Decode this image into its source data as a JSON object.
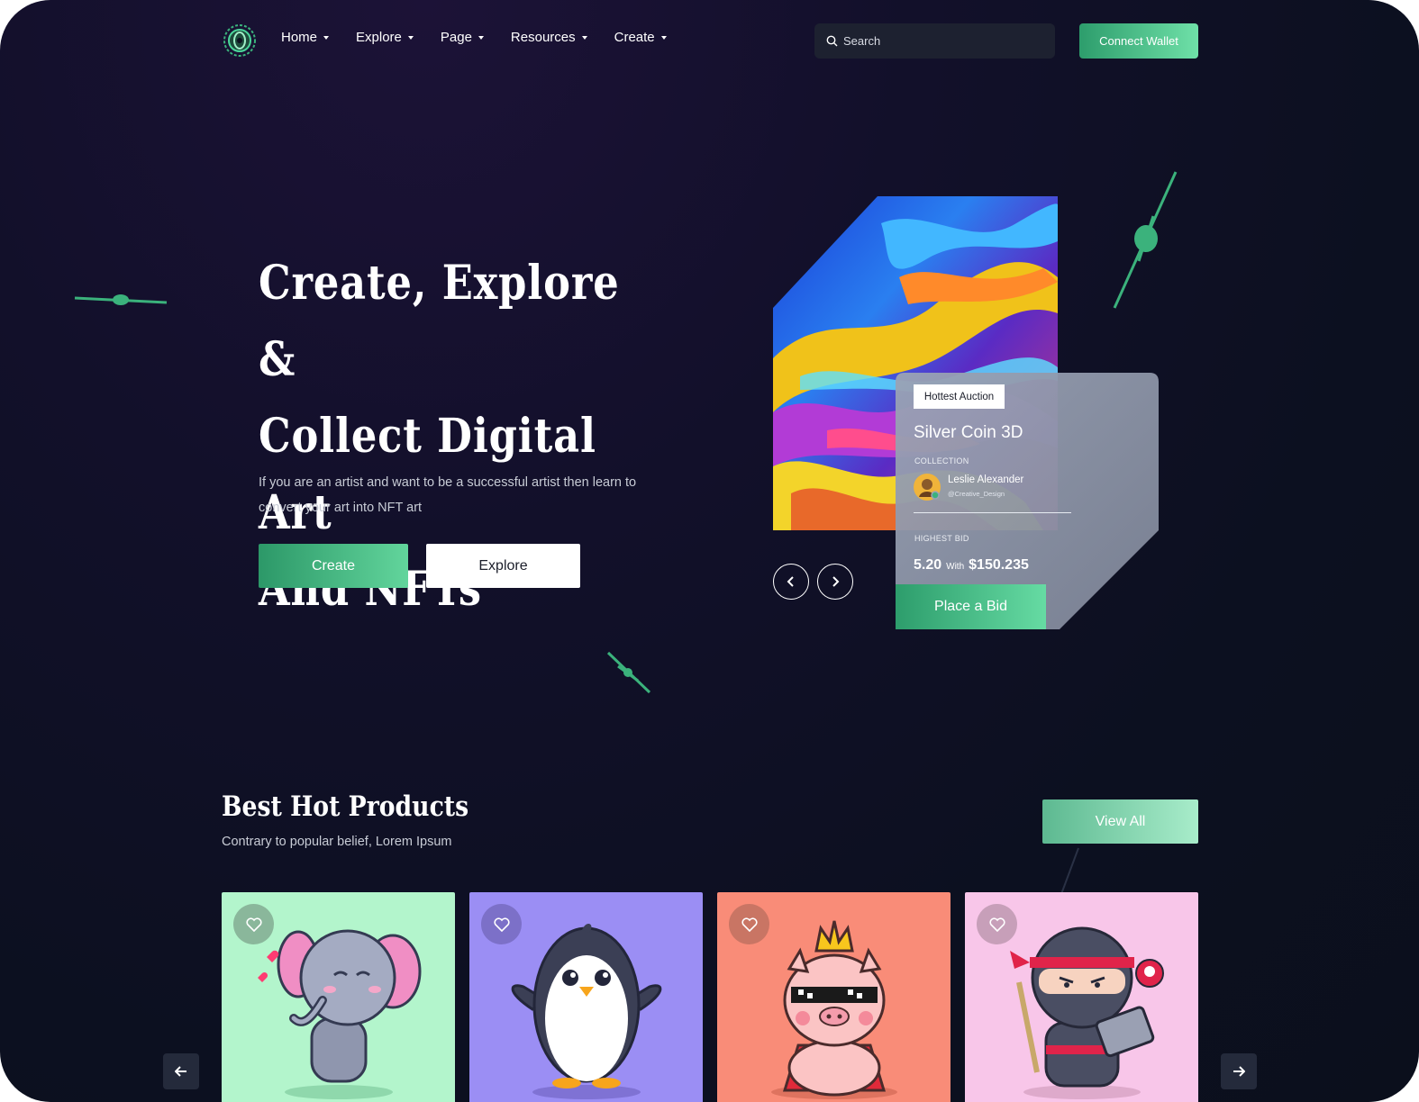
{
  "nav": {
    "logo_icon": "eye-logo-icon",
    "items": [
      {
        "label": "Home"
      },
      {
        "label": "Explore"
      },
      {
        "label": "Page"
      },
      {
        "label": "Resources"
      },
      {
        "label": "Create"
      }
    ],
    "search_placeholder": "Search",
    "connect_wallet_label": "Connect Wallet"
  },
  "hero": {
    "title_lines": [
      "Create, Explore &",
      "Collect Digital Art",
      "And NFTs"
    ],
    "subtitle": "If you are an artist and want to be a successful artist then learn to convert your art into NFT art",
    "create_label": "Create",
    "explore_label": "Explore"
  },
  "auction": {
    "badge": "Hottest Auction",
    "title": "Silver Coin 3D",
    "collection_label": "COLLECTION",
    "owner_name": "Leslie Alexander",
    "owner_handle": "@Creative_Design",
    "highest_bid_label": "HIGHEST BID",
    "bid_amount": "5.20",
    "bid_with": "With",
    "bid_usd": "$150.235",
    "place_bid_label": "Place a Bid"
  },
  "products": {
    "title": "Best Hot Products",
    "subtitle": "Contrary to popular belief, Lorem Ipsum",
    "view_all_label": "View All",
    "cards": [
      {
        "image": "elephant-illustration",
        "bg": "#b3f5cc"
      },
      {
        "image": "penguin-illustration",
        "bg": "#9b8ef4"
      },
      {
        "image": "king-pig-illustration",
        "bg": "#f98c78"
      },
      {
        "image": "ninja-illustration",
        "bg": "#f8c6e9"
      }
    ]
  },
  "colors": {
    "accent_green": "#3bb27c",
    "background": "#0e1120"
  }
}
